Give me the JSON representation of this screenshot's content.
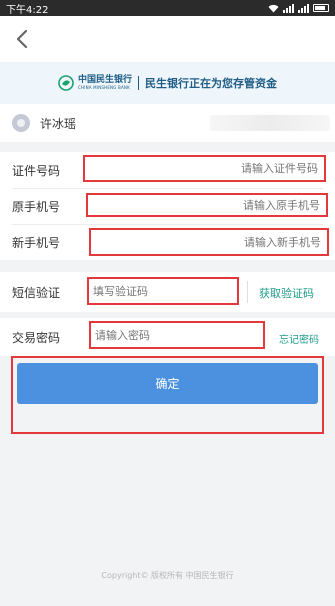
{
  "status_bar": {
    "time": "下午4:22"
  },
  "nav": {
    "back": "back"
  },
  "banner": {
    "bank_name_cn": "中国民生银行",
    "bank_name_en": "CHINA MINSHENG BANK",
    "slogan": "民生银行正在为您存管资金"
  },
  "user": {
    "name": "许冰瑶"
  },
  "form": {
    "id_number": {
      "label": "证件号码",
      "placeholder": "请输入证件号码"
    },
    "old_phone": {
      "label": "原手机号",
      "placeholder": "请输入原手机号"
    },
    "new_phone": {
      "label": "新手机号",
      "placeholder": "请输入新手机号"
    },
    "sms": {
      "label": "短信验证",
      "placeholder": "填写验证码",
      "action": "获取验证码"
    },
    "password": {
      "label": "交易密码",
      "placeholder": "请输入密码",
      "action": "忘记密码"
    }
  },
  "confirm_label": "确定",
  "footer": {
    "text": "Copyright© 版权所有 中国民生银行"
  },
  "colors": {
    "accent": "#4b91e0",
    "link": "#1f9b8a",
    "highlight": "#e4393c",
    "brand": "#1f5d86"
  }
}
